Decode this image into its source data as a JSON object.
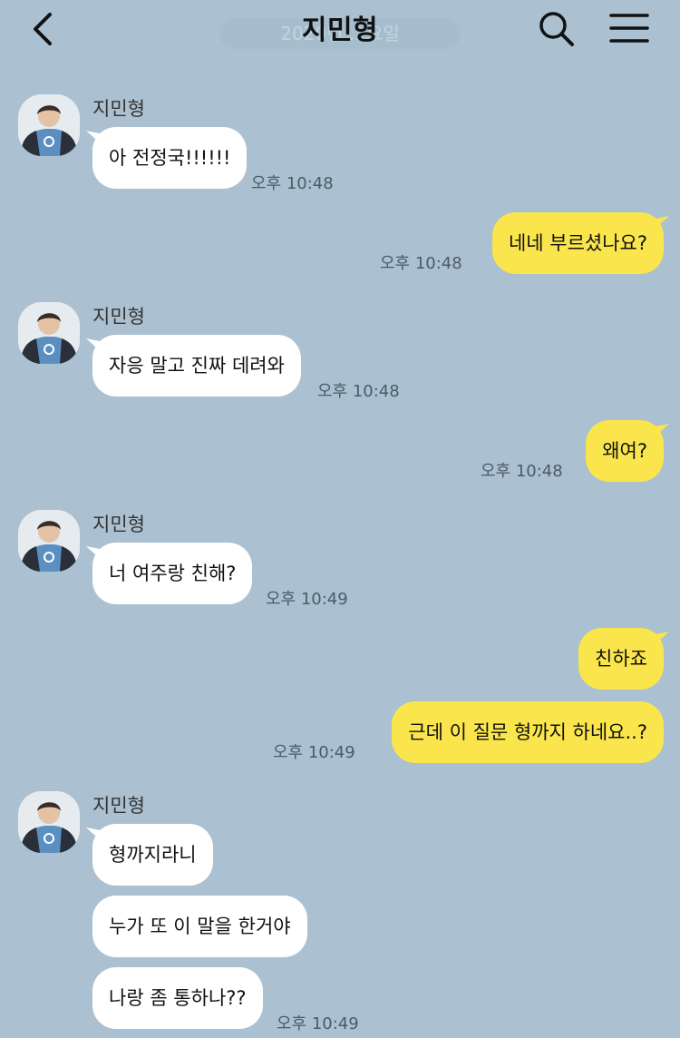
{
  "header": {
    "title": "지민형",
    "date_label": "2020년 ...요일",
    "back_icon": "chevron-left-icon",
    "search_icon": "search-icon",
    "menu_icon": "menu-icon"
  },
  "colors": {
    "background": "#abc1d1",
    "incoming_bubble": "#ffffff",
    "outgoing_bubble": "#fae64c"
  },
  "messages": [
    {
      "sender": "지민형",
      "text": "아 전정국!!!!!!",
      "time": "오후 10:48"
    },
    {
      "text": "네네 부르셨나요?",
      "time": "오후 10:48"
    },
    {
      "sender": "지민형",
      "text": "자응 말고 진짜 데려와",
      "time": "오후 10:48"
    },
    {
      "text": "왜여?",
      "time": "오후 10:48"
    },
    {
      "sender": "지민형",
      "text": "너 여주랑 친해?",
      "time": "오후 10:49"
    },
    {
      "text": "친하죠"
    },
    {
      "text": "근데 이 질문 형까지 하네요..?",
      "time": "오후 10:49"
    },
    {
      "sender": "지민형",
      "text": "형까지라니"
    },
    {
      "text": "누가 또 이 말을 한거야"
    },
    {
      "text": "나랑 좀 통하나??",
      "time": "오후 10:49"
    }
  ]
}
